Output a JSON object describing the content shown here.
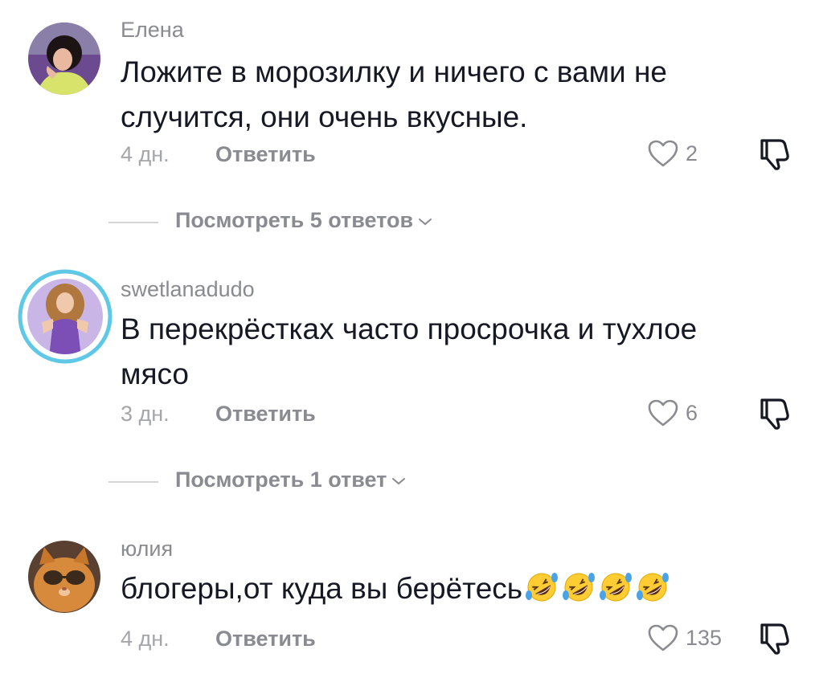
{
  "comments": [
    {
      "username": "Елена",
      "text": "Ложите в морозилку и ничего с вами не случится, они очень вкусные.",
      "time": "4 дн.",
      "reply_label": "Ответить",
      "likes": "2",
      "avatar_icon": "avatar-photo-woman"
    },
    {
      "username": "swetlanadudo",
      "text": "В перекрёстках часто просрочка и тухлое мясо",
      "time": "3 дн.",
      "reply_label": "Ответить",
      "likes": "6",
      "avatar_icon": "avatar-photo-woman-with-story-ring"
    },
    {
      "username": "юлия",
      "text": "блогеры,от куда вы берётесь",
      "emoji": [
        "rofl-emoji",
        "rofl-emoji",
        "rofl-emoji",
        "rofl-emoji"
      ],
      "time": "4 дн.",
      "reply_label": "Ответить",
      "likes": "135",
      "avatar_icon": "avatar-photo-cat-with-sunglasses"
    }
  ],
  "view_replies": [
    {
      "label": "Посмотреть 5 ответов"
    },
    {
      "label": "Посмотреть 1 ответ"
    }
  ],
  "icons": {
    "like": "heart-outline-icon",
    "dislike": "thumbs-down-icon",
    "expand": "chevron-down-icon"
  },
  "colors": {
    "text": "#161823",
    "secondary": "#8a8b91",
    "story_ring": "#5ec8e6"
  }
}
